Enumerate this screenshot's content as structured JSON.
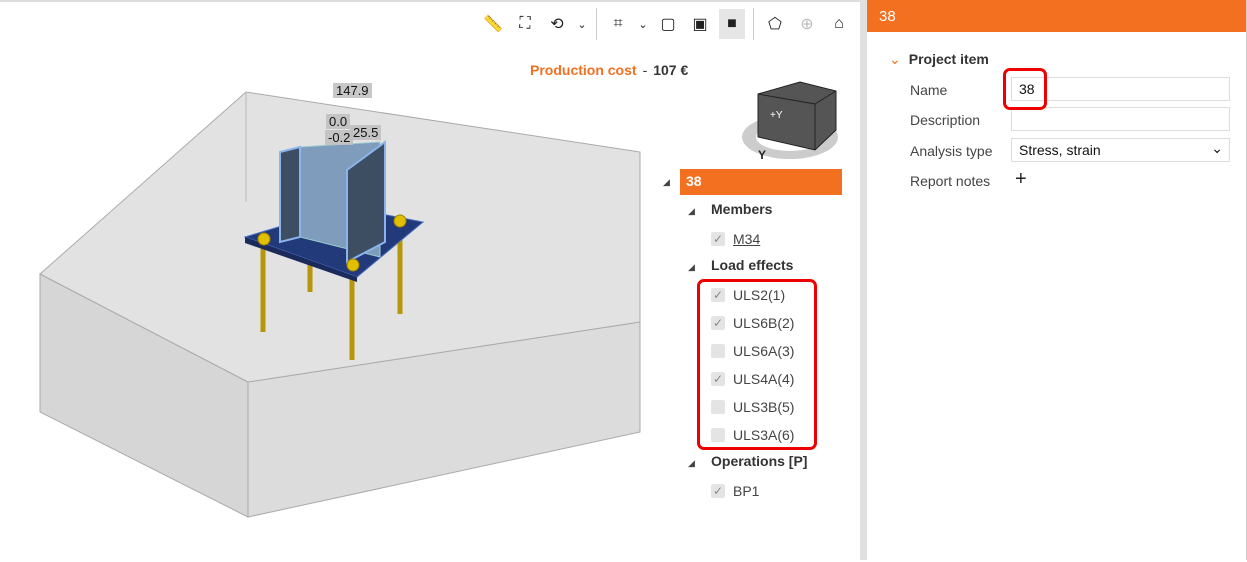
{
  "toolbar": {
    "icons": [
      "ruler-icon",
      "fit-view-icon",
      "rotate-icon",
      "chevron-down-icon",
      "crop-icon",
      "chevron-down-icon",
      "wireframe-icon",
      "transparent-icon",
      "solid-icon",
      "perspective-icon",
      "axis-rotate-icon",
      "home-icon"
    ]
  },
  "cost": {
    "label": "Production cost",
    "separator": "-",
    "value": "107 €"
  },
  "dimensions": [
    "147.9",
    "0.0",
    "-0.2",
    "25.5"
  ],
  "navcube": {
    "face_label": "+Y",
    "axis_label": "Y"
  },
  "tree": {
    "root": "38",
    "members_label": "Members",
    "members": [
      {
        "label": "M34",
        "checked": true
      }
    ],
    "load_effects_label": "Load effects",
    "load_effects": [
      {
        "label": "ULS2(1)",
        "checked": true
      },
      {
        "label": "ULS6B(2)",
        "checked": true
      },
      {
        "label": "ULS6A(3)",
        "checked": false
      },
      {
        "label": "ULS4A(4)",
        "checked": true
      },
      {
        "label": "ULS3B(5)",
        "checked": false
      },
      {
        "label": "ULS3A(6)",
        "checked": false
      }
    ],
    "operations_label": "Operations [P]",
    "operations": [
      {
        "label": "BP1",
        "checked": true
      }
    ]
  },
  "panel": {
    "title": "38",
    "section": "Project item",
    "name_label": "Name",
    "name_value": "38",
    "description_label": "Description",
    "description_value": "",
    "analysis_label": "Analysis type",
    "analysis_value": "Stress, strain",
    "notes_label": "Report notes",
    "notes_add": "+"
  },
  "colors": {
    "accent": "#f37021",
    "highlight": "#e00000"
  }
}
